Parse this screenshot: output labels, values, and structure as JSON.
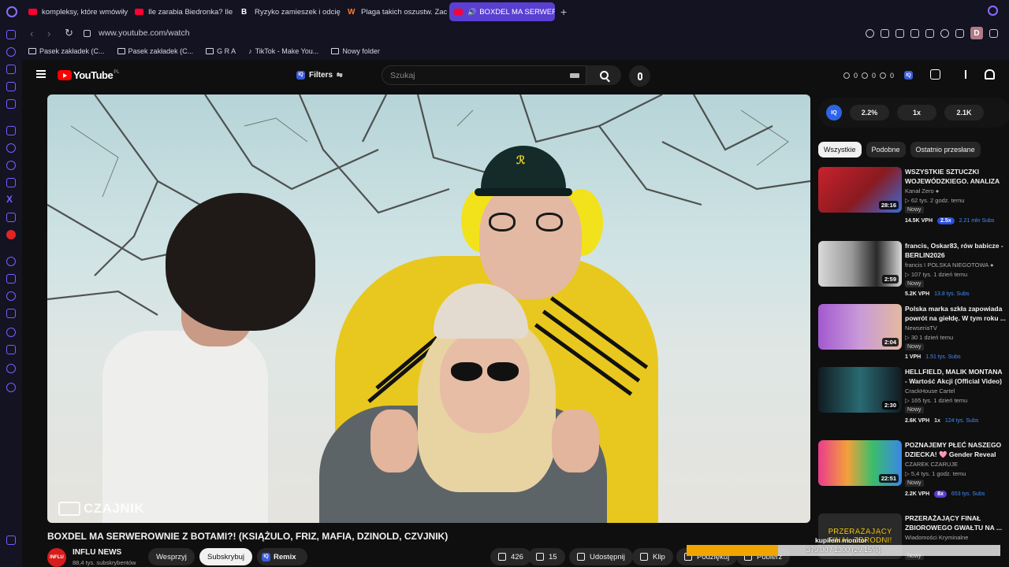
{
  "browser": {
    "tabs": [
      {
        "label": "kompleksy, które wmówiły",
        "icon": "youtube-icon",
        "active": false
      },
      {
        "label": "Ile zarabia Biedronka? Ile",
        "icon": "youtube-icon",
        "active": false
      },
      {
        "label": "Ryzyko zamieszek i odcię",
        "icon": "b-icon",
        "active": false
      },
      {
        "label": "Plaga takich oszustw. Zac",
        "icon": "w-icon",
        "active": false
      },
      {
        "label": "BOXDEL MA SERWERO",
        "icon": "youtube-icon",
        "active": true
      }
    ],
    "new_tab": "+",
    "url": "www.youtube.com/watch",
    "profile_initial": "D",
    "accent": "#7b5cff",
    "bookmarks": [
      {
        "label": "Pasek zakładek (C...",
        "icon": "folder-icon"
      },
      {
        "label": "Pasek zakładek (C...",
        "icon": "folder-icon"
      },
      {
        "label": "G R A",
        "icon": "folder-icon"
      },
      {
        "label": "TikTok - Make You...",
        "icon": "tiktok-icon"
      },
      {
        "label": "Nowy folder",
        "icon": "folder-icon"
      }
    ]
  },
  "youtube": {
    "logo": "YouTube",
    "country": "PL",
    "filters_label": "Filters",
    "search_placeholder": "Szukaj",
    "header_stats": [
      "0",
      "0",
      "0"
    ],
    "video": {
      "title": "BOXDEL MA SERWEROWNIE Z BOTAMI?! (KSIĄŻULO, FRIZ, MAFIA, DZINOLD, CZVJNIK)",
      "watermark": "CZAJNIK",
      "channel": "INFLU NEWS",
      "channel_avatar_text": "INFLU",
      "subscribers": "88,4 tys. subskrybentów",
      "support_label": "Wesprzyj",
      "subscribe_label": "Subskrybuj",
      "remix_label": "Remix",
      "likes": "426",
      "dislikes": "15",
      "share_label": "Udostępnij",
      "clip_label": "Klip",
      "thanks_label": "Podziękuj",
      "download_label": "Pobierz"
    },
    "iq_bar": {
      "logo": "IQ",
      "stat1": "2.2%",
      "stat2": "1x",
      "stat3": "2.1K"
    },
    "chips": [
      "Wszystkie",
      "Podobne",
      "Ostatnio przesłane"
    ],
    "recommendations": [
      {
        "title": "WSZYSTKIE SZTUCZKI WOJEWÓDZKIEGO. ANALIZA ...",
        "channel": "Kanał Zero",
        "verified": true,
        "views": "▷ 62 tys.  2 godz. temu",
        "new": "Nowy",
        "vph": "14.5K VPH",
        "multiplier": "2.5x",
        "subs": "2.21 mln Subs",
        "duration": "28:16",
        "thumb_colors": [
          "#c8222b",
          "#3a6bd6"
        ]
      },
      {
        "title": "francis, Oskar83, rów babicze - BERLIN2026",
        "channel": "francis  I POLSKA NIEGOTOWA",
        "verified": true,
        "views": "▷ 107 tys.  1 dzień temu",
        "new": "Nowy",
        "vph": "5.2K VPH",
        "multiplier": "",
        "subs": "13.8 tys. Subs",
        "duration": "2:59",
        "thumb_colors": [
          "#d9d9d9",
          "#2a2a2a"
        ]
      },
      {
        "title": "Polska marka szkła zapowiada powrót na giełdę. W tym roku ...",
        "channel": "NewseriaTV",
        "verified": false,
        "views": "▷ 30  1 dzień temu",
        "new": "Nowy",
        "vph": "1 VPH",
        "multiplier": "",
        "subs": "1.51 tys. Subs",
        "duration": "2:04",
        "thumb_colors": [
          "#a25ad0",
          "#e3b9a0"
        ]
      },
      {
        "title": "HELLFIELD, MALIK MONTANA - Wartość Akcji (Official Video)",
        "channel": "CrackHouse Cartel",
        "verified": false,
        "views": "▷ 165 tys.  1 dzień temu",
        "new": "Nowy",
        "vph": "2.6K VPH",
        "multiplier": "1x",
        "subs": "124 tys. Subs",
        "duration": "2:30",
        "thumb_colors": [
          "#2a6a72",
          "#111b22"
        ]
      },
      {
        "title": "POZNAJEMY PŁEĆ NASZEGO DZIECKA! 🩷 Gender Reveal",
        "channel": "CZAREK CZARUJE",
        "verified": false,
        "views": "▷ 5,4 tys.  1 godz. temu",
        "new": "Nowy",
        "vph": "2.2K VPH",
        "multiplier": "8x",
        "subs": "653 tys. Subs",
        "duration": "22:51",
        "thumb_colors": [
          "#e93c8c",
          "#3bbd6a"
        ]
      },
      {
        "title": "PRZERAŻAJĄCY FINAŁ ZBIOROWEGO GWAŁTU NA ...",
        "channel": "Wiadomości Kryminalne",
        "verified": false,
        "views": "",
        "new": "Nowy",
        "vph": "",
        "multiplier": "",
        "subs": "",
        "duration": "",
        "thumb_text": "PRZERAŻAJĄCY FINAŁ ZBRODNI!",
        "thumb_colors": [
          "#e6c21c",
          "#2a2a2a"
        ]
      }
    ]
  },
  "download_overlay": {
    "label": "kupiłem monitor",
    "progress_text": "379.00 / 1300 (29.15%)",
    "progress": 0.2915,
    "color": "#f0a500"
  }
}
